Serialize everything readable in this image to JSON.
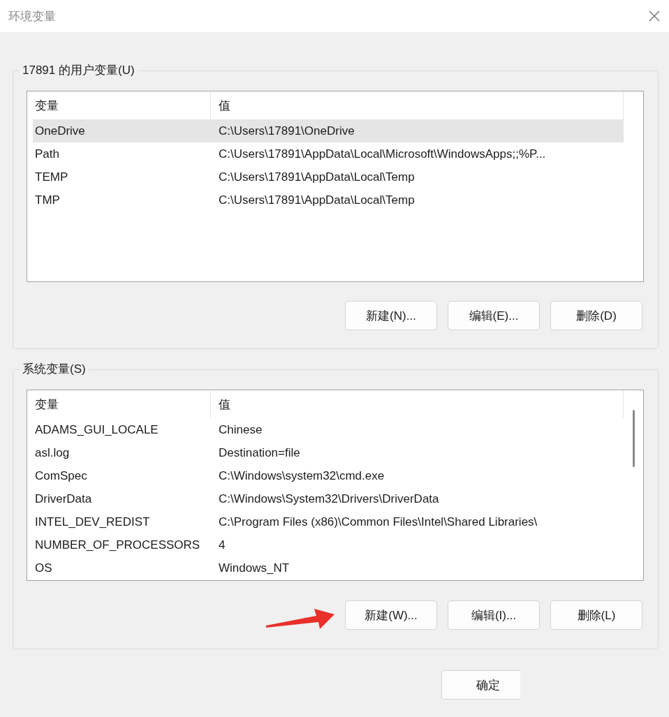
{
  "window": {
    "title": "环境变量"
  },
  "user_variables": {
    "label": "17891 的用户变量(U)",
    "columns": [
      "变量",
      "值"
    ],
    "rows": [
      {
        "name": "OneDrive",
        "value": "C:\\Users\\17891\\OneDrive",
        "selected": true
      },
      {
        "name": "Path",
        "value": "C:\\Users\\17891\\AppData\\Local\\Microsoft\\WindowsApps;;%P...",
        "selected": false
      },
      {
        "name": "TEMP",
        "value": "C:\\Users\\17891\\AppData\\Local\\Temp",
        "selected": false
      },
      {
        "name": "TMP",
        "value": "C:\\Users\\17891\\AppData\\Local\\Temp",
        "selected": false
      }
    ],
    "buttons": [
      "新建(N)...",
      "编辑(E)...",
      "删除(D)"
    ]
  },
  "system_variables": {
    "label": "系统变量(S)",
    "columns": [
      "变量",
      "值"
    ],
    "rows": [
      {
        "name": "ADAMS_GUI_LOCALE",
        "value": "Chinese",
        "selected": false
      },
      {
        "name": "asl.log",
        "value": "Destination=file",
        "selected": false
      },
      {
        "name": "ComSpec",
        "value": "C:\\Windows\\system32\\cmd.exe",
        "selected": false
      },
      {
        "name": "DriverData",
        "value": "C:\\Windows\\System32\\Drivers\\DriverData",
        "selected": false
      },
      {
        "name": "INTEL_DEV_REDIST",
        "value": "C:\\Program Files (x86)\\Common Files\\Intel\\Shared Libraries\\",
        "selected": false
      },
      {
        "name": "NUMBER_OF_PROCESSORS",
        "value": "4",
        "selected": false
      },
      {
        "name": "OS",
        "value": "Windows_NT",
        "selected": false
      }
    ],
    "buttons": [
      "新建(W)...",
      "编辑(I)...",
      "删除(L)"
    ]
  },
  "dialog_buttons": [
    "确定"
  ]
}
